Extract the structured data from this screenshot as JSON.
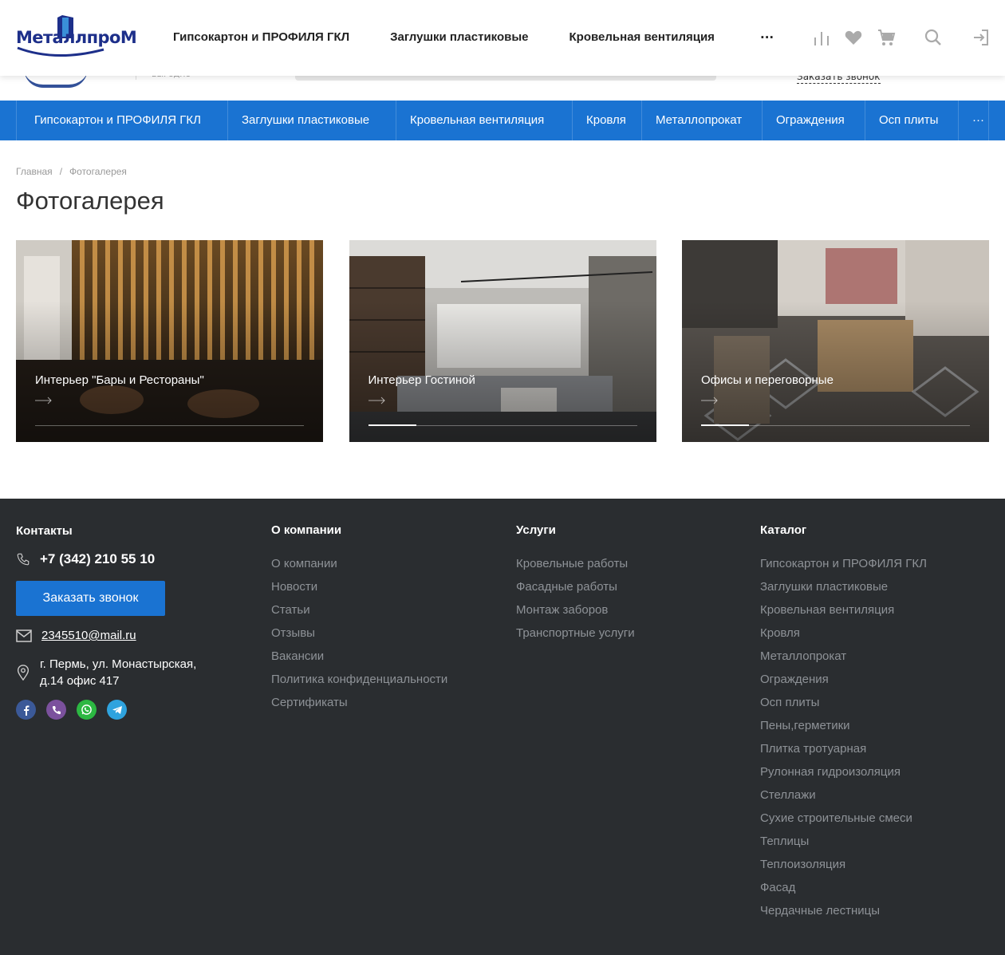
{
  "header": {
    "logo_text": "МеталлпроМ",
    "slogan": "выгодно",
    "callback_link": "Заказать звонок",
    "fixed_nav": [
      "Гипсокартон и ПРОФИЛЯ ГКЛ",
      "Заглушки пластиковые",
      "Кровельная вентиляция"
    ],
    "more": "···",
    "icons": [
      "compare-icon",
      "heart-icon",
      "cart-icon",
      "search-icon",
      "login-icon"
    ]
  },
  "menu": {
    "items": [
      "Гипсокартон и ПРОФИЛЯ ГКЛ",
      "Заглушки пластиковые",
      "Кровельная вентиляция",
      "Кровля",
      "Металлопрокат",
      "Ограждения",
      "Осп плиты",
      "···"
    ]
  },
  "breadcrumb": {
    "home": "Главная",
    "separator": "/",
    "current": "Фотогалерея"
  },
  "page": {
    "title": "Фотогалерея"
  },
  "gallery": [
    {
      "title": "Интерьер \"Бары и Рестораны\""
    },
    {
      "title": "Интерьер Гостиной"
    },
    {
      "title": "Офисы и переговорные"
    }
  ],
  "footer": {
    "contacts": {
      "heading": "Контакты",
      "phone": "+7 (342) 210 55 10",
      "callback_button": "Заказать звонок",
      "email": "2345510@mail.ru",
      "address": "г. Пермь, ул. Монастырская, д.14 офис 417",
      "socials": [
        "facebook-icon",
        "viber-icon",
        "whatsapp-icon",
        "telegram-icon"
      ]
    },
    "company": {
      "heading": "О компании",
      "links": [
        "О компании",
        "Новости",
        "Статьи",
        "Отзывы",
        "Вакансии",
        "Политика конфиденциальности",
        "Сертификаты"
      ]
    },
    "services": {
      "heading": "Услуги",
      "links": [
        "Кровельные работы",
        "Фасадные работы",
        "Монтаж заборов",
        "Транспортные услуги"
      ]
    },
    "catalog": {
      "heading": "Каталог",
      "links": [
        "Гипсокартон и ПРОФИЛЯ ГКЛ",
        "Заглушки пластиковые",
        "Кровельная вентиляция",
        "Кровля",
        "Металлопрокат",
        "Ограждения",
        "Осп плиты",
        "Пены,герметики",
        "Плитка тротуарная",
        "Рулонная гидроизоляция",
        "Стеллажи",
        "Сухие строительные смеси",
        "Теплицы",
        "Теплоизоляция",
        "Фасад",
        "Чердачные лестницы"
      ]
    }
  },
  "colors": {
    "accent": "#1a73d2",
    "footer_bg": "#2a2d30",
    "logo_blue": "#1d2f8a"
  }
}
